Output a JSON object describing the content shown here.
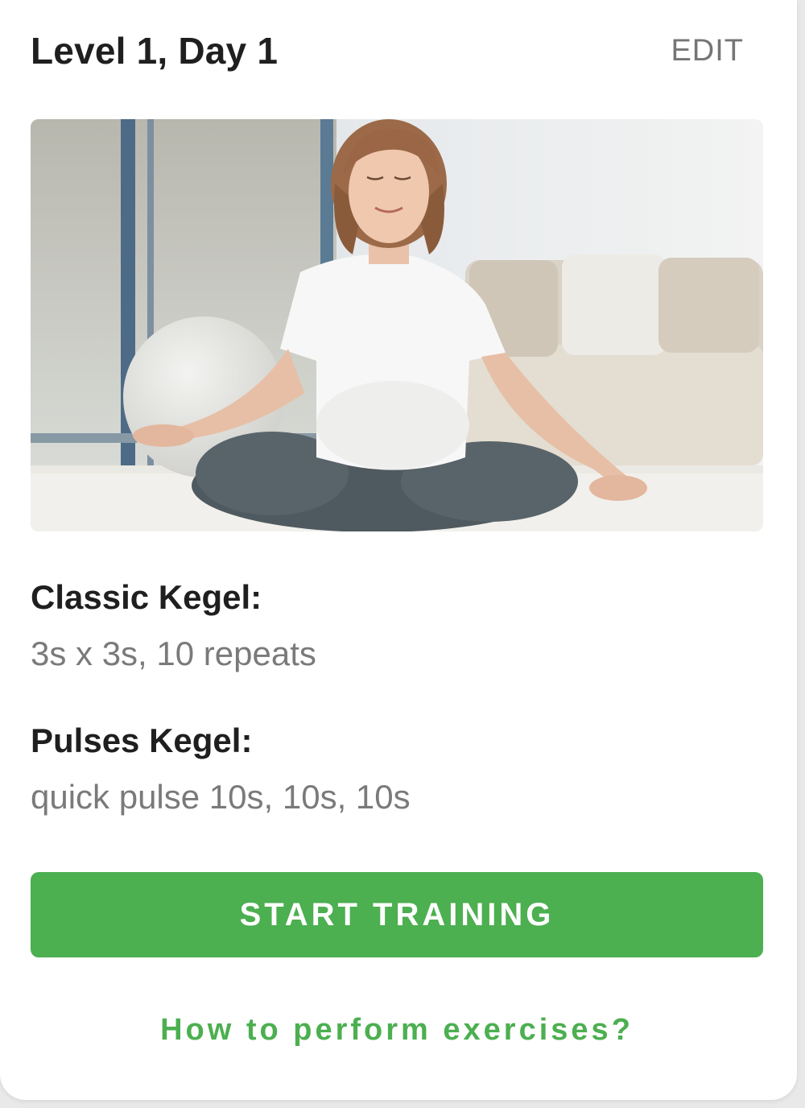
{
  "header": {
    "title": "Level 1, Day 1",
    "edit_label": "EDIT"
  },
  "hero": {
    "image_description": "pregnant-woman-meditating-photo"
  },
  "exercises": [
    {
      "name": "Classic Kegel:",
      "detail": "3s x 3s, 10 repeats"
    },
    {
      "name": "Pulses Kegel:",
      "detail": "quick pulse 10s, 10s, 10s"
    }
  ],
  "actions": {
    "start_label": "START TRAINING",
    "howto_label": "How to perform exercises?"
  },
  "colors": {
    "accent": "#4caf50",
    "title": "#1f1f1f",
    "secondary_text": "#7a7a7a"
  }
}
